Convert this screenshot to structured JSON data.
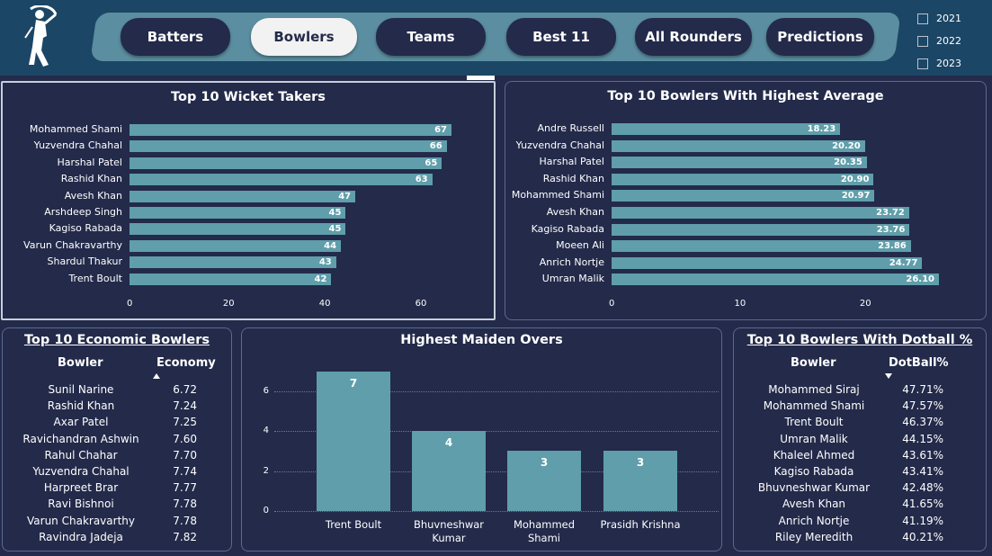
{
  "nav": {
    "tabs": [
      {
        "label": "Batters",
        "active": false
      },
      {
        "label": "Bowlers",
        "active": true
      },
      {
        "label": "Teams",
        "active": false
      },
      {
        "label": "Best 11",
        "active": false
      },
      {
        "label": "All Rounders",
        "active": false
      },
      {
        "label": "Predictions",
        "active": false
      }
    ]
  },
  "years": [
    "2021",
    "2022",
    "2023"
  ],
  "colors": {
    "background": "#232a4a",
    "topbar": "#1c4665",
    "nav_pill": "#5a8ea0",
    "bar": "#5f9eaa"
  },
  "wicket_takers": {
    "title": "Top 10 Wicket Takers",
    "chart_data": {
      "type": "bar",
      "orientation": "horizontal",
      "categories": [
        "Mohammed Shami",
        "Yuzvendra Chahal",
        "Harshal Patel",
        "Rashid Khan",
        "Avesh Khan",
        "Arshdeep Singh",
        "Kagiso Rabada",
        "Varun Chakravarthy",
        "Shardul Thakur",
        "Trent Boult"
      ],
      "values": [
        67,
        66,
        65,
        63,
        47,
        45,
        45,
        44,
        43,
        42
      ],
      "xticks": [
        "0",
        "20",
        "40",
        "60"
      ],
      "xlim": [
        0,
        67
      ]
    }
  },
  "highest_average": {
    "title": "Top 10 Bowlers With Highest Average",
    "chart_data": {
      "type": "bar",
      "orientation": "horizontal",
      "categories": [
        "Andre Russell",
        "Yuzvendra Chahal",
        "Harshal Patel",
        "Rashid Khan",
        "Mohammed Shami",
        "Avesh Khan",
        "Kagiso Rabada",
        "Moeen Ali",
        "Anrich Nortje",
        "Umran Malik"
      ],
      "values": [
        "18.23",
        "20.20",
        "20.35",
        "20.90",
        "20.97",
        "23.72",
        "23.76",
        "23.86",
        "24.77",
        "26.10"
      ],
      "xticks": [
        "0",
        "10",
        "20"
      ],
      "xlim": [
        0,
        26.1
      ]
    }
  },
  "economic": {
    "title": "Top 10 Economic Bowlers",
    "col_bowler": "Bowler",
    "col_value": "Economy",
    "sort": "ascending",
    "rows": [
      {
        "name": "Sunil Narine",
        "value": "6.72"
      },
      {
        "name": "Rashid Khan",
        "value": "7.24"
      },
      {
        "name": "Axar Patel",
        "value": "7.25"
      },
      {
        "name": "Ravichandran Ashwin",
        "value": "7.60"
      },
      {
        "name": "Rahul Chahar",
        "value": "7.70"
      },
      {
        "name": "Yuzvendra Chahal",
        "value": "7.74"
      },
      {
        "name": "Harpreet Brar",
        "value": "7.77"
      },
      {
        "name": "Ravi Bishnoi",
        "value": "7.78"
      },
      {
        "name": "Varun Chakravarthy",
        "value": "7.78"
      },
      {
        "name": "Ravindra Jadeja",
        "value": "7.82"
      }
    ]
  },
  "maiden_overs": {
    "title": "Highest Maiden Overs",
    "chart_data": {
      "type": "bar",
      "orientation": "vertical",
      "categories": [
        [
          "Trent Boult"
        ],
        [
          "Bhuvneshwar",
          "Kumar"
        ],
        [
          "Mohammed",
          "Shami"
        ],
        [
          "Prasidh Krishna"
        ]
      ],
      "values": [
        7,
        4,
        3,
        3
      ],
      "yticks": [
        "0",
        "2",
        "4",
        "6"
      ],
      "ylim": [
        0,
        7.8
      ],
      "grid": true
    }
  },
  "dotball": {
    "title": "Top 10 Bowlers With Dotball %",
    "col_bowler": "Bowler",
    "col_value": "DotBall%",
    "sort": "descending",
    "rows": [
      {
        "name": "Mohammed Siraj",
        "value": "47.71%"
      },
      {
        "name": "Mohammed Shami",
        "value": "47.57%"
      },
      {
        "name": "Trent Boult",
        "value": "46.37%"
      },
      {
        "name": "Umran Malik",
        "value": "44.15%"
      },
      {
        "name": "Khaleel Ahmed",
        "value": "43.61%"
      },
      {
        "name": "Kagiso Rabada",
        "value": "43.41%"
      },
      {
        "name": "Bhuvneshwar Kumar",
        "value": "42.48%"
      },
      {
        "name": "Avesh Khan",
        "value": "41.65%"
      },
      {
        "name": "Anrich Nortje",
        "value": "41.19%"
      },
      {
        "name": "Riley Meredith",
        "value": "40.21%"
      }
    ]
  }
}
